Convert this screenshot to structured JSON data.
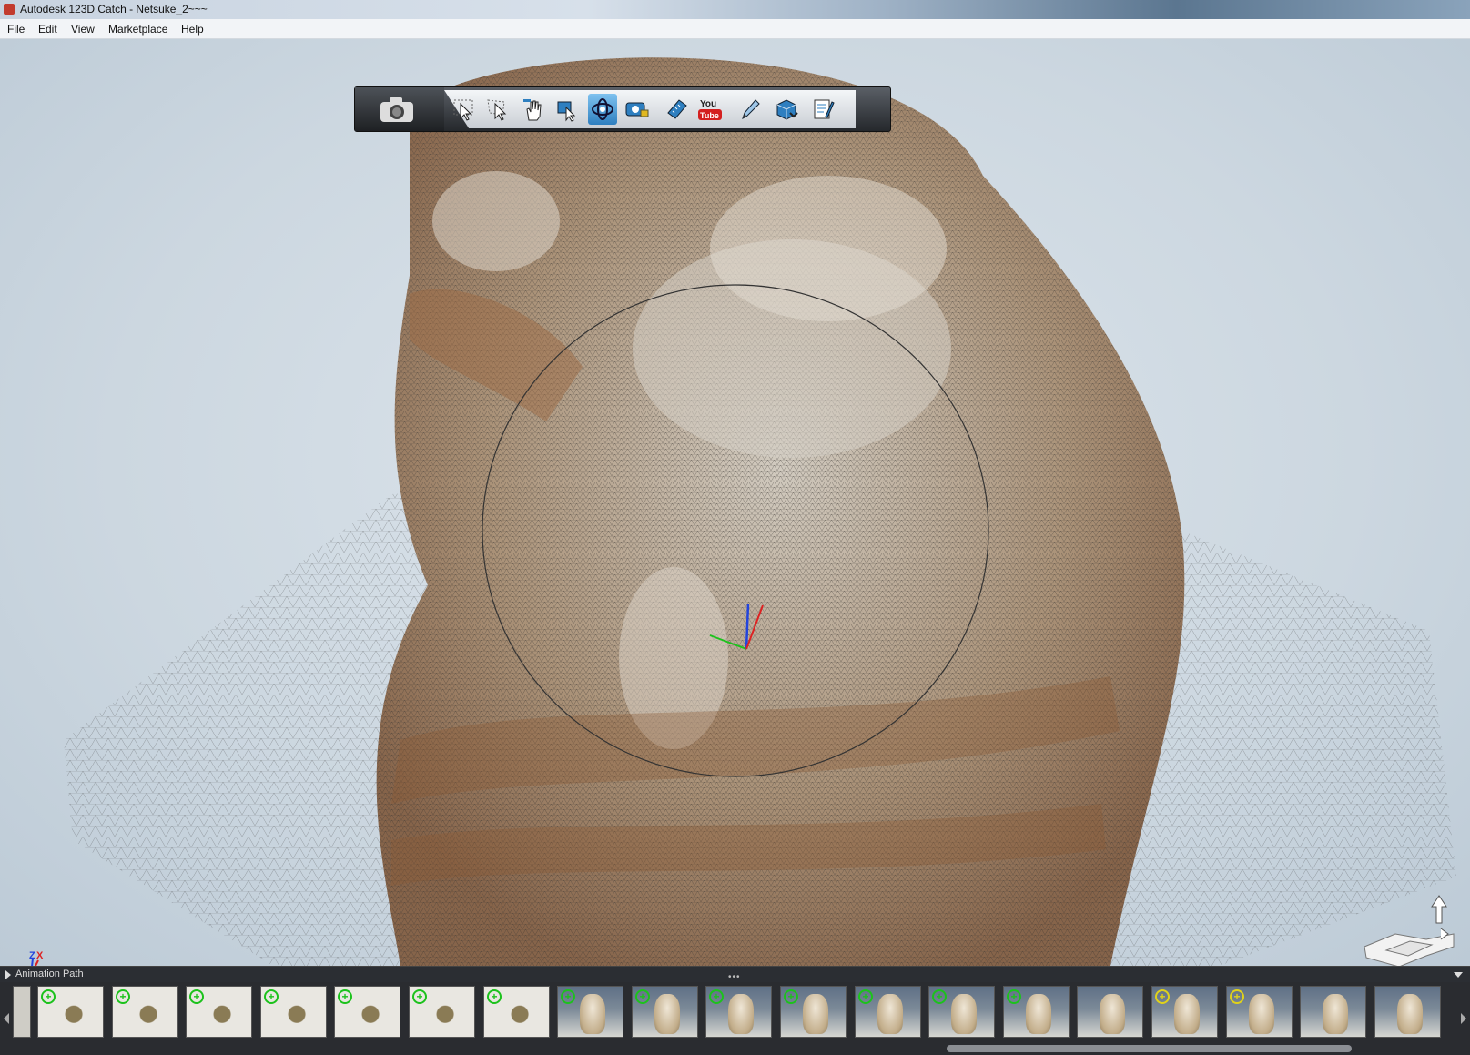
{
  "window": {
    "title": "Autodesk 123D Catch - Netsuke_2~~~"
  },
  "menu": {
    "items": [
      "File",
      "Edit",
      "View",
      "Marketplace",
      "Help"
    ]
  },
  "toolbar": {
    "tools": [
      {
        "name": "select-arrow-icon",
        "active": false
      },
      {
        "name": "lasso-select-icon",
        "active": false
      },
      {
        "name": "pan-hand-icon",
        "active": false
      },
      {
        "name": "zoom-icon",
        "active": false
      },
      {
        "name": "orbit-icon",
        "active": true
      },
      {
        "name": "camera-lock-icon",
        "active": false
      },
      {
        "name": "ruler-icon",
        "active": false
      },
      {
        "name": "youtube-icon",
        "active": false,
        "label": "You\nTube"
      },
      {
        "name": "pen-icon",
        "active": false
      },
      {
        "name": "mesh-export-icon",
        "active": false
      },
      {
        "name": "notes-icon",
        "active": false
      }
    ]
  },
  "axis": {
    "x_label": "X",
    "z_label": "Z"
  },
  "animation_panel": {
    "label": "Animation Path",
    "grip": "•••"
  },
  "filmstrip": {
    "thumbs": [
      {
        "kind": "flat",
        "marker": "green"
      },
      {
        "kind": "flat",
        "marker": "green"
      },
      {
        "kind": "flat",
        "marker": "green"
      },
      {
        "kind": "flat",
        "marker": "green"
      },
      {
        "kind": "flat",
        "marker": "green"
      },
      {
        "kind": "flat",
        "marker": "green"
      },
      {
        "kind": "flat",
        "marker": "green"
      },
      {
        "kind": "stand",
        "marker": "green"
      },
      {
        "kind": "stand",
        "marker": "green"
      },
      {
        "kind": "stand",
        "marker": "green"
      },
      {
        "kind": "stand",
        "marker": "green"
      },
      {
        "kind": "stand",
        "marker": "green"
      },
      {
        "kind": "stand",
        "marker": "green"
      },
      {
        "kind": "stand",
        "marker": "green"
      },
      {
        "kind": "stand",
        "marker": "none"
      },
      {
        "kind": "stand",
        "marker": "yellow"
      },
      {
        "kind": "stand",
        "marker": "yellow"
      },
      {
        "kind": "stand",
        "marker": "none"
      },
      {
        "kind": "stand",
        "marker": "none"
      }
    ],
    "marker_symbol": "+"
  },
  "colors": {
    "accent": "#2e7fc0",
    "viewport_bg": "#ccd7e0",
    "mesh": "#8a5a35"
  }
}
